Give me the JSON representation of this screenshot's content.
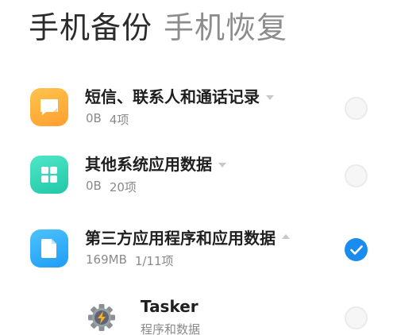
{
  "tabs": [
    {
      "label": "手机备份",
      "active": true
    },
    {
      "label": "手机恢复",
      "active": false
    }
  ],
  "items": [
    {
      "title": "短信、联系人和通话记录",
      "size": "0B",
      "count": "4项",
      "icon": "message-icon",
      "icon_color": "#ffb13d",
      "expanded": false,
      "checked": false
    },
    {
      "title": "其他系统应用数据",
      "size": "0B",
      "count": "20项",
      "icon": "grid-apps-icon",
      "icon_color": "#2fd3b4",
      "expanded": false,
      "checked": false
    },
    {
      "title": "第三方应用程序和应用数据",
      "size": "169MB",
      "count": "1/11项",
      "icon": "document-icon",
      "icon_color": "#2aa8ff",
      "expanded": true,
      "checked": true
    }
  ],
  "sub_items": [
    {
      "name": "Tasker",
      "desc": "程序和数据",
      "icon": "tasker-gear-icon",
      "checked": false
    }
  ],
  "colors": {
    "accent": "#1a8cf0",
    "text_primary": "#1f1f1f",
    "text_secondary": "#8a8a8a",
    "tab_inactive": "#8c8c8c"
  }
}
